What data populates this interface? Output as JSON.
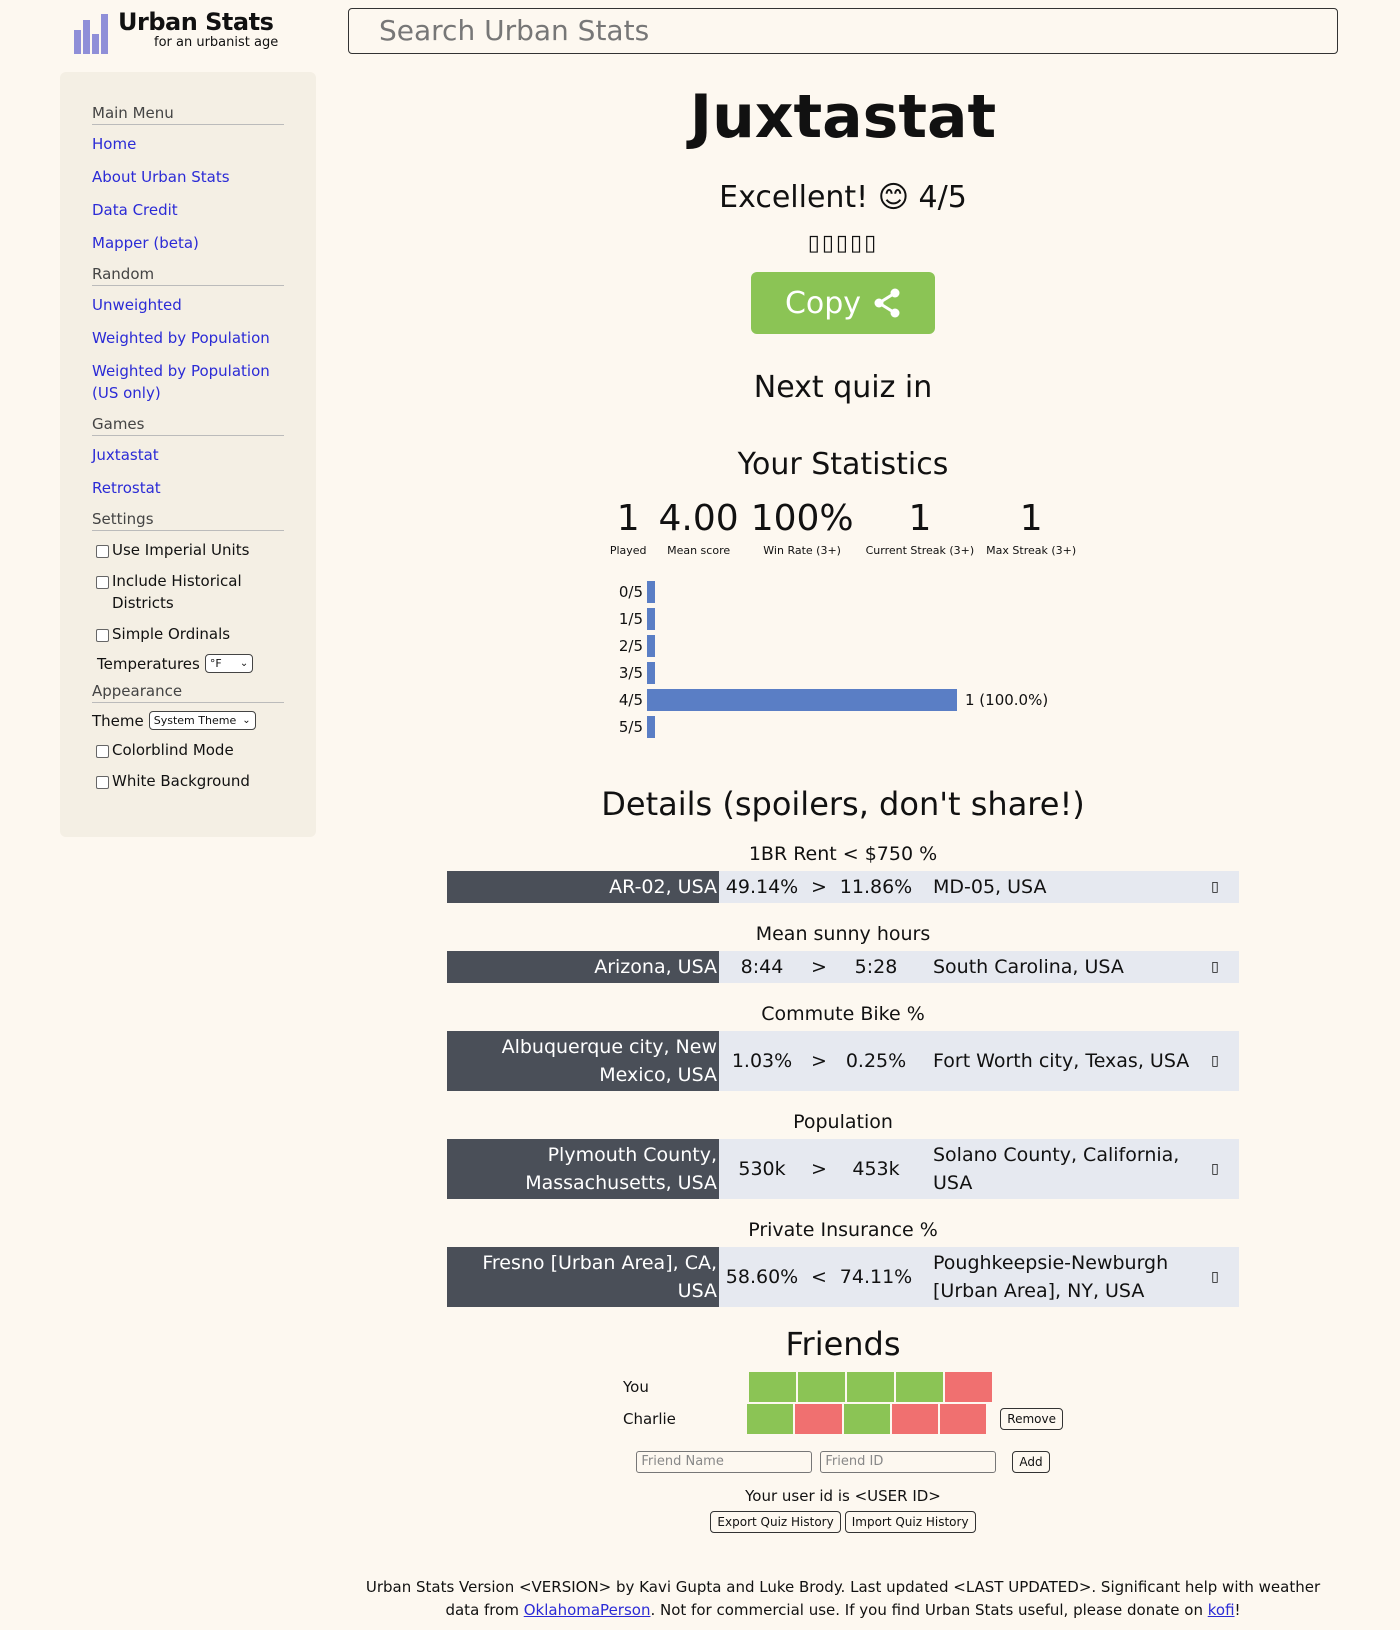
{
  "header": {
    "brand_title": "Urban Stats",
    "brand_sub": "for an urbanist age",
    "search_placeholder": "Search Urban Stats"
  },
  "sidebar": {
    "main_menu": "Main Menu",
    "home": "Home",
    "about": "About Urban Stats",
    "data_credit": "Data Credit",
    "mapper": "Mapper (beta)",
    "random": "Random",
    "unweighted": "Unweighted",
    "weighted_pop": "Weighted by Population",
    "weighted_pop_us": "Weighted by Population (US only)",
    "games": "Games",
    "juxtastat": "Juxtastat",
    "retrostat": "Retrostat",
    "settings": "Settings",
    "imperial": "Use Imperial Units",
    "historical": "Include Historical Districts",
    "ordinals": "Simple Ordinals",
    "temperatures": "Temperatures",
    "temp_value": "°F",
    "appearance": "Appearance",
    "theme": "Theme",
    "theme_value": "System Theme",
    "colorblind": "Colorblind Mode",
    "white_bg": "White Background"
  },
  "main": {
    "title": "Juxtastat",
    "result": "Excellent! 😊 4/5",
    "emoji_row": "▯▯▯▯▯",
    "copy": "Copy",
    "next_quiz": "Next quiz in",
    "stats_title": "Your Statistics",
    "stats": [
      {
        "value": "1",
        "label": "Played"
      },
      {
        "value": "4.00",
        "label": "Mean score"
      },
      {
        "value": "100%",
        "label": "Win Rate (3+)"
      },
      {
        "value": "1",
        "label": "Current Streak (3+)"
      },
      {
        "value": "1",
        "label": "Max Streak (3+)"
      }
    ],
    "histogram": [
      {
        "label": "0/5",
        "fraction": 0,
        "text": ""
      },
      {
        "label": "1/5",
        "fraction": 0,
        "text": ""
      },
      {
        "label": "2/5",
        "fraction": 0,
        "text": ""
      },
      {
        "label": "3/5",
        "fraction": 0,
        "text": ""
      },
      {
        "label": "4/5",
        "fraction": 1.0,
        "text": "1 (100.0%)"
      },
      {
        "label": "5/5",
        "fraction": 0,
        "text": ""
      }
    ],
    "details_title": "Details (spoilers, don't share!)",
    "questions": [
      {
        "stat": "1BR Rent < $750 %",
        "left": "AR-02, USA",
        "v1": "49.14%",
        "op": ">",
        "v2": "11.86%",
        "right": "MD-05, USA",
        "icon": "▯"
      },
      {
        "stat": "Mean sunny hours",
        "left": "Arizona, USA",
        "v1": "8:44",
        "op": ">",
        "v2": "5:28",
        "right": "South Carolina, USA",
        "icon": "▯"
      },
      {
        "stat": "Commute Bike %",
        "left": "Albuquerque city, New Mexico, USA",
        "v1": "1.03%",
        "op": ">",
        "v2": "0.25%",
        "right": "Fort Worth city, Texas, USA",
        "icon": "▯"
      },
      {
        "stat": "Population",
        "left": "Plymouth County, Massachusetts, USA",
        "v1": "530k",
        "op": ">",
        "v2": "453k",
        "right": "Solano County, California, USA",
        "icon": "▯"
      },
      {
        "stat": "Private Insurance %",
        "left": "Fresno [Urban Area], CA, USA",
        "v1": "58.60%",
        "op": "<",
        "v2": "74.11%",
        "right": "Poughkeepsie-Newburgh [Urban Area], NY, USA",
        "icon": "▯"
      }
    ],
    "friends_title": "Friends",
    "friends": [
      {
        "name": "You",
        "results": [
          "correct",
          "correct",
          "correct",
          "correct",
          "wrong"
        ],
        "button": ""
      },
      {
        "name": "Charlie",
        "results": [
          "correct",
          "wrong",
          "correct",
          "wrong",
          "wrong"
        ],
        "button": "Remove"
      }
    ],
    "friend_name_placeholder": "Friend Name",
    "friend_id_placeholder": "Friend ID",
    "add": "Add",
    "user_id": "Your user id is <USER ID>",
    "export": "Export Quiz History",
    "import": "Import Quiz History"
  },
  "footer": {
    "text1": "Urban Stats Version <VERSION> by Kavi Gupta and Luke Brody. Last updated <LAST UPDATED>. Significant help with weather data from",
    "link1": "OklahomaPerson",
    "text2": ". Not for commercial use. If you find Urban Stats useful, please donate on",
    "link2": "kofi",
    "text3": "!"
  },
  "colors": {
    "correct": "#8bc455",
    "wrong": "#f07070",
    "bar": "#5a7ec5",
    "link": "#2b2bd6"
  }
}
